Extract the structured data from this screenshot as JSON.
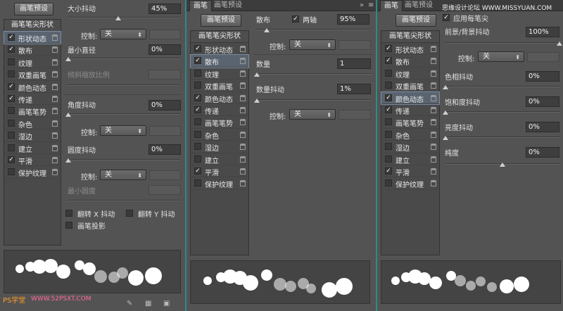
{
  "panel1": {
    "preset_button": "画笔预设",
    "list_header": "画笔笔尖形状",
    "items": [
      {
        "label": "形状动态",
        "checked": true
      },
      {
        "label": "散布",
        "checked": true
      },
      {
        "label": "纹理",
        "checked": false
      },
      {
        "label": "双重画笔",
        "checked": false
      },
      {
        "label": "颜色动态",
        "checked": true
      },
      {
        "label": "传递",
        "checked": true
      },
      {
        "label": "画笔笔势",
        "checked": false
      },
      {
        "label": "杂色",
        "checked": false
      },
      {
        "label": "湿边",
        "checked": false
      },
      {
        "label": "建立",
        "checked": false
      },
      {
        "label": "平滑",
        "checked": true
      },
      {
        "label": "保护纹理",
        "checked": false
      }
    ],
    "size_jitter_label": "大小抖动",
    "size_jitter_value": "45%",
    "control_label": "控制:",
    "control_value": "关",
    "min_diameter_label": "最小直径",
    "min_diameter_value": "0%",
    "tilt_scale_label": "倾斜缩放比例",
    "angle_jitter_label": "角度抖动",
    "angle_jitter_value": "0%",
    "roundness_jitter_label": "圆度抖动",
    "roundness_jitter_value": "0%",
    "min_roundness_label": "最小圆度",
    "flip_x_label": "翻转 X 抖动",
    "flip_y_label": "翻转 Y 抖动",
    "brush_projection_label": "画笔投影"
  },
  "panel2": {
    "tab_brush": "画笔",
    "tab_preset": "画笔预设",
    "preset_button": "画笔预设",
    "list_header": "画笔笔尖形状",
    "items": [
      {
        "label": "形状动态",
        "checked": true
      },
      {
        "label": "散布",
        "checked": true
      },
      {
        "label": "纹理",
        "checked": false
      },
      {
        "label": "双重画笔",
        "checked": false
      },
      {
        "label": "颜色动态",
        "checked": true
      },
      {
        "label": "传递",
        "checked": true
      },
      {
        "label": "画笔笔势",
        "checked": false
      },
      {
        "label": "杂色",
        "checked": false
      },
      {
        "label": "湿边",
        "checked": false
      },
      {
        "label": "建立",
        "checked": false
      },
      {
        "label": "平滑",
        "checked": true
      },
      {
        "label": "保护纹理",
        "checked": false
      }
    ],
    "scatter_label": "散布",
    "both_axes_label": "两轴",
    "scatter_value": "95%",
    "control_label": "控制:",
    "control_value": "关",
    "count_label": "数量",
    "count_value": "1",
    "count_jitter_label": "数量抖动",
    "count_jitter_value": "1%",
    "control2_value": "关"
  },
  "panel3": {
    "tab_brush": "画笔",
    "tab_preset": "画笔预设",
    "watermark": "思缘设计论坛 WWW.MISSYUAN.COM",
    "preset_button": "画笔预设",
    "list_header": "画笔笔尖形状",
    "apply_per_tip": "应用每笔尖",
    "items": [
      {
        "label": "形状动态",
        "checked": true
      },
      {
        "label": "散布",
        "checked": true
      },
      {
        "label": "纹理",
        "checked": false
      },
      {
        "label": "双重画笔",
        "checked": false
      },
      {
        "label": "颜色动态",
        "checked": true
      },
      {
        "label": "传递",
        "checked": true
      },
      {
        "label": "画笔笔势",
        "checked": false
      },
      {
        "label": "杂色",
        "checked": false
      },
      {
        "label": "湿边",
        "checked": false
      },
      {
        "label": "建立",
        "checked": false
      },
      {
        "label": "平滑",
        "checked": true
      },
      {
        "label": "保护纹理",
        "checked": false
      }
    ],
    "fg_bg_jitter_label": "前景/背景抖动",
    "fg_bg_jitter_value": "100%",
    "control_label": "控制:",
    "control_value": "关",
    "hue_jitter_label": "色相抖动",
    "hue_jitter_value": "0%",
    "sat_jitter_label": "饱和度抖动",
    "sat_jitter_value": "0%",
    "bright_jitter_label": "亮度抖动",
    "bright_jitter_value": "0%",
    "purity_label": "纯度",
    "purity_value": "0%"
  },
  "footer": {
    "brand": "PS学堂",
    "site": "WWW.52PSXT.COM"
  },
  "icons": {
    "check": "✓",
    "arrow": "◆"
  }
}
